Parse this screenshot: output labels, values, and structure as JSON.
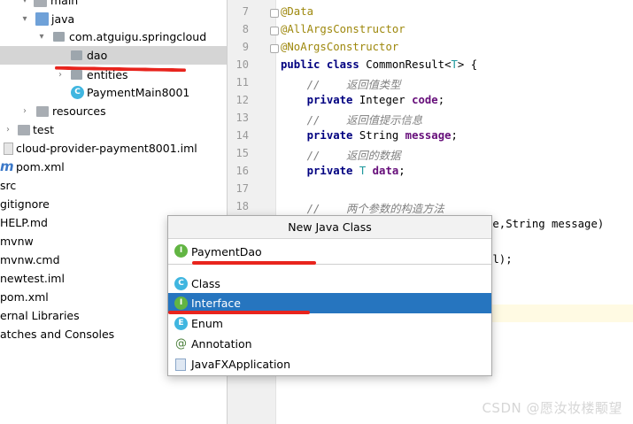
{
  "tree": [
    {
      "label": "main",
      "arrow": "▾",
      "icon": "folder-icon"
    },
    {
      "label": "java",
      "arrow": "▾",
      "icon": "folder-icon"
    },
    {
      "label": "com.atguigu.springcloud",
      "arrow": "▾",
      "icon": "package-icon"
    },
    {
      "label": "dao",
      "arrow": "",
      "icon": "package-icon"
    },
    {
      "label": "entities",
      "arrow": "›",
      "icon": "package-icon"
    },
    {
      "label": "PaymentMain8001",
      "arrow": "",
      "icon": "spring-class-icon"
    },
    {
      "label": "resources",
      "arrow": "›",
      "icon": "resources-folder-icon"
    },
    {
      "label": "test",
      "arrow": "›",
      "icon": "folder-icon"
    },
    {
      "label": "cloud-provider-payment8001.iml",
      "arrow": "",
      "icon": "iml-file-icon"
    },
    {
      "label": "pom.xml",
      "arrow": "",
      "icon": "maven-icon"
    },
    {
      "label": "src",
      "arrow": "",
      "icon": ""
    },
    {
      "label": "gitignore",
      "arrow": "",
      "icon": ""
    },
    {
      "label": "HELP.md",
      "arrow": "",
      "icon": ""
    },
    {
      "label": "mvnw",
      "arrow": "",
      "icon": ""
    },
    {
      "label": "mvnw.cmd",
      "arrow": "",
      "icon": ""
    },
    {
      "label": "newtest.iml",
      "arrow": "",
      "icon": ""
    },
    {
      "label": "pom.xml",
      "arrow": "",
      "icon": ""
    },
    {
      "label": "ernal Libraries",
      "arrow": "",
      "icon": ""
    },
    {
      "label": "atches and Consoles",
      "arrow": "",
      "icon": ""
    }
  ],
  "gutter": [
    "7",
    "8",
    "9",
    "10",
    "11",
    "12",
    "13",
    "14",
    "15",
    "16",
    "17",
    "18"
  ],
  "code": {
    "l7": "@Data",
    "l8": "@AllArgsConstructor",
    "l9": "@NoArgsConstructor",
    "l10_kw": "public class",
    "l10_rest": " CommonResult<",
    "l10_t": "T",
    "l10_end": "> {",
    "l11": "    //    返回值类型",
    "l12_kw": "    private",
    "l12_type": " Integer ",
    "l12_field": "code",
    "l12_end": ";",
    "l13": "    //    返回值提示信息",
    "l14_kw": "    private",
    "l14_type": " String ",
    "l14_field": "message",
    "l14_end": ";",
    "l15": "    //    返回的数据",
    "l16_kw": "    private",
    "l16_t": " T ",
    "l16_field": "data",
    "l16_end": ";",
    "l18": "    //    两个参数的构造方法",
    "l19_tail": "de,String message)",
    "l20_tail": "ll);"
  },
  "dialog": {
    "title": "New Java Class",
    "input_value": "PaymentDao",
    "options": [
      {
        "label": "Class",
        "icon": "class-icon"
      },
      {
        "label": "Interface",
        "icon": "interface-icon"
      },
      {
        "label": "Enum",
        "icon": "enum-icon"
      },
      {
        "label": "Annotation",
        "icon": "annotation-icon"
      },
      {
        "label": "JavaFXApplication",
        "icon": "javafx-icon"
      }
    ],
    "selected_index": 1
  },
  "watermark": "CSDN @愿汝妆楼颙望",
  "colors": {
    "selection": "#2675bf",
    "annotation_underline": "#e8241d"
  }
}
